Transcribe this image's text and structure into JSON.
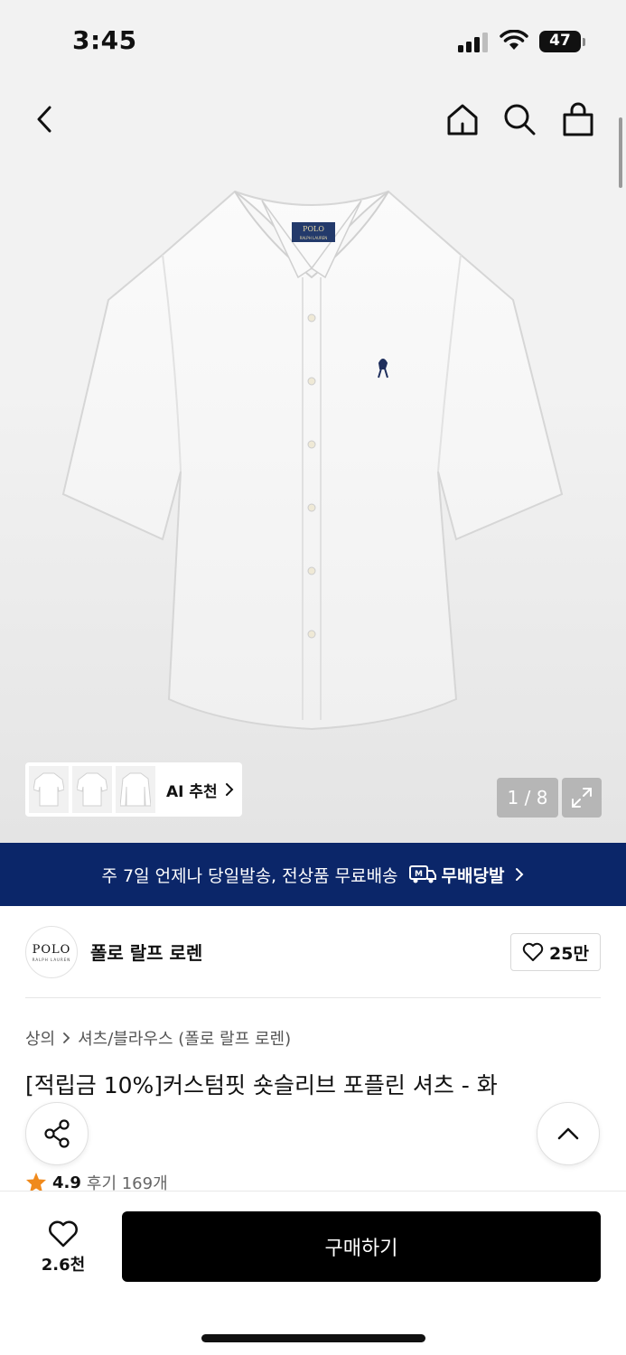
{
  "status_bar": {
    "time": "3:45",
    "battery": "47"
  },
  "header": {
    "back_icon": "chevron-left-icon",
    "home_icon": "home-icon",
    "search_icon": "search-icon",
    "cart_icon": "shopping-bag-icon"
  },
  "gallery": {
    "thumbnails": [
      "shirt-front-thumb",
      "shirt-back-thumb",
      "shirt-long-thumb"
    ],
    "ai_label": "AI 추천",
    "pager": "1 / 8",
    "shirt_label_top": "POLO",
    "shirt_label_bottom": "RALPH LAUREN"
  },
  "banner": {
    "text": "주 7일 언제나 당일발송, 전상품 무료배송",
    "brand_label": "무배당발",
    "color": "#0b2669"
  },
  "brand": {
    "logo_main": "POLO",
    "logo_sub": "RALPH LAUREN",
    "name": "폴로 랄프 로렌",
    "likes": "25만"
  },
  "product": {
    "breadcrumb_category": "상의",
    "breadcrumb_sub": "셔츠/블라우스 (폴로 랄프 로렌)",
    "title": "[적립금 10%]커스텀핏 숏슬리브 포플린 셔츠 - 화",
    "rating": "4.9",
    "reviews": "후기 169개"
  },
  "bottom_bar": {
    "wish_count": "2.6천",
    "buy_label": "구매하기"
  }
}
